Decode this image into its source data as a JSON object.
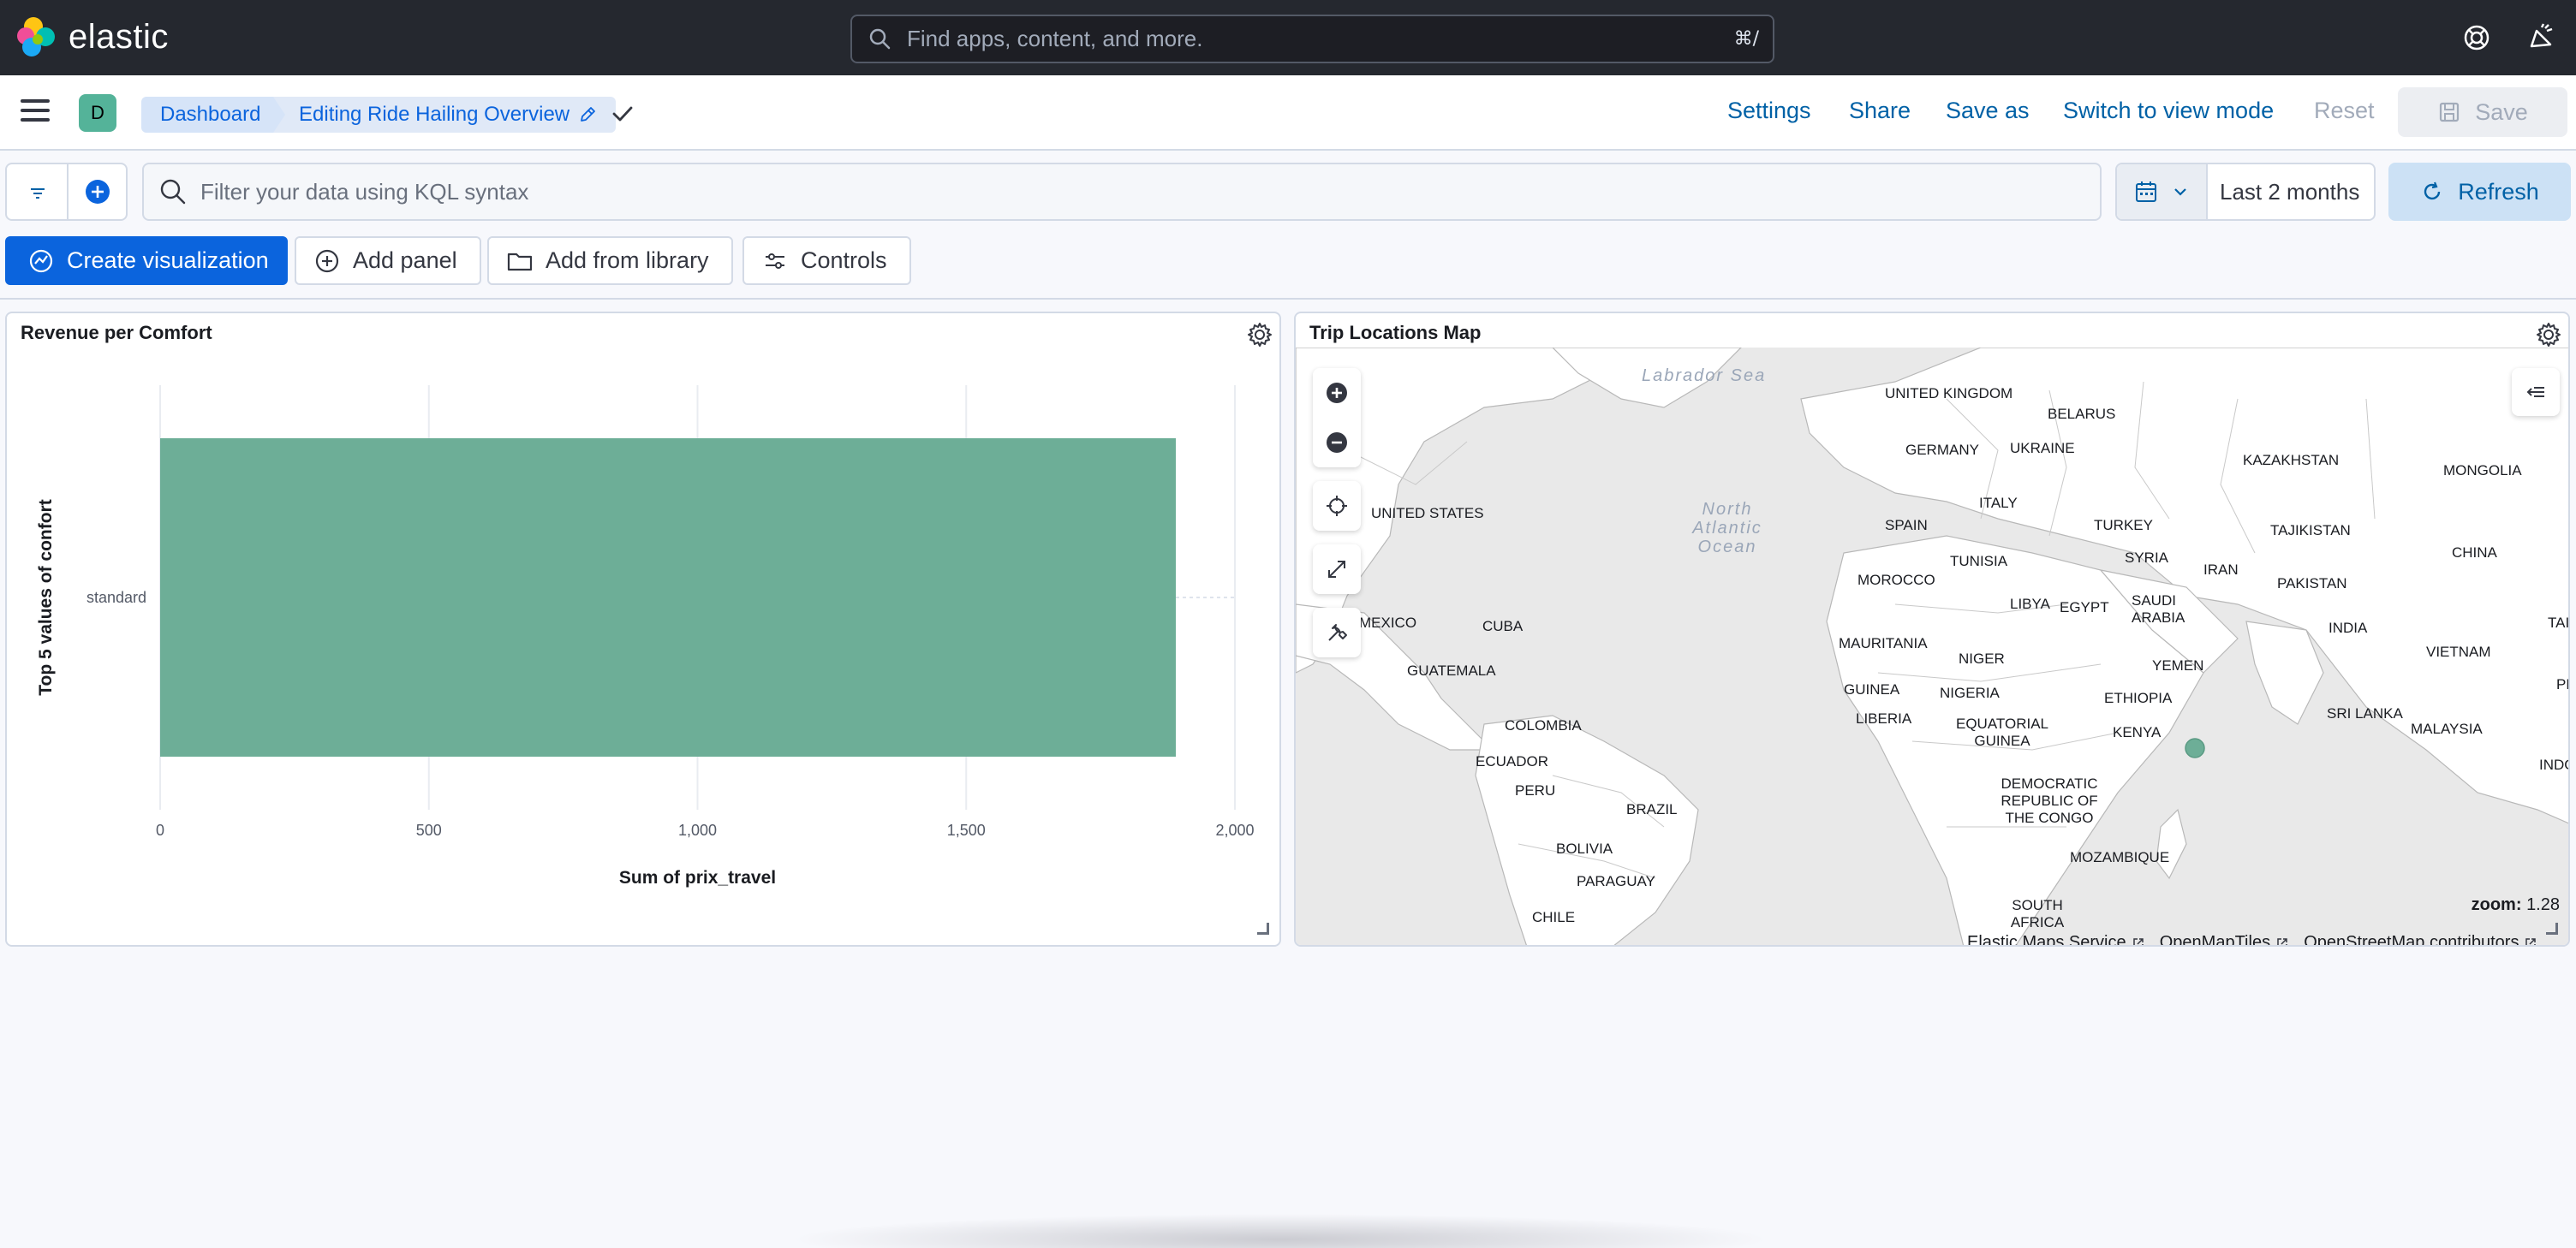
{
  "app": {
    "logo_text": "elastic",
    "search_placeholder": "Find apps, content, and more.",
    "search_shortcut": "⌘/"
  },
  "nav": {
    "space_initial": "D",
    "breadcrumbs": [
      "Dashboard",
      "Editing Ride Hailing Overview"
    ],
    "links": {
      "settings": "Settings",
      "share": "Share",
      "save_as": "Save as",
      "switch_mode": "Switch to view mode",
      "reset": "Reset",
      "save": "Save"
    }
  },
  "query": {
    "kql_placeholder": "Filter your data using KQL syntax",
    "date_range": "Last 2 months",
    "refresh_label": "Refresh"
  },
  "actions": {
    "create_visualization": "Create visualization",
    "add_panel": "Add panel",
    "add_from_library": "Add from library",
    "controls": "Controls"
  },
  "panels": {
    "revenue": {
      "title": "Revenue per Comfort"
    },
    "map": {
      "title": "Trip Locations Map",
      "zoom_label": "zoom:",
      "zoom_value": "1.28",
      "attribution": [
        "Elastic Maps Service",
        "OpenMapTiles",
        "OpenStreetMap contributors"
      ],
      "oceans": [
        "Labrador Sea",
        "North Atlantic Ocean"
      ],
      "countries": [
        "UNITED KINGDOM",
        "BELARUS",
        "GERMANY",
        "UKRAINE",
        "KAZAKHSTAN",
        "MONGOLIA",
        "UNITED STATES",
        "SPAIN",
        "ITALY",
        "TURKEY",
        "TAJIKISTAN",
        "CHINA",
        "TUNISIA",
        "SYRIA",
        "IRAN",
        "PAKISTAN",
        "MOROCCO",
        "LIBYA",
        "EGYPT",
        "SAUDI ARABIA",
        "INDIA",
        "MEXICO",
        "CUBA",
        "MAURITANIA",
        "NIGER",
        "YEMEN",
        "VIETNAM",
        "TAI",
        "GUATEMALA",
        "GUINEA",
        "NIGERIA",
        "ETHIOPIA",
        "SRI LANKA",
        "PHIL",
        "LIBERIA",
        "MALAYSIA",
        "COLOMBIA",
        "EQUATORIAL GUINEA",
        "KENYA",
        "INDON",
        "ECUADOR",
        "DEMOCRATIC REPUBLIC OF THE CONGO",
        "PERU",
        "BRAZIL",
        "BOLIVIA",
        "MOZAMBIQUE",
        "PARAGUAY",
        "CHILE",
        "SOUTH AFRICA"
      ]
    }
  },
  "chart_data": {
    "type": "bar",
    "orientation": "horizontal",
    "categories": [
      "standard"
    ],
    "values": [
      1890
    ],
    "xlabel": "Sum of prix_travel",
    "ylabel": "Top 5 values of confort",
    "xlim": [
      0,
      2000
    ],
    "xticks": [
      0,
      500,
      1000,
      1500,
      2000
    ],
    "xtick_labels": [
      "0",
      "500",
      "1,000",
      "1,500",
      "2,000"
    ],
    "grid": true,
    "color": "#6dae97"
  },
  "colors": {
    "header_bg": "#25282f",
    "primary": "#0b64dd",
    "bar": "#6dae97",
    "avatar": "#54b399",
    "map_point": "#6dae97"
  }
}
